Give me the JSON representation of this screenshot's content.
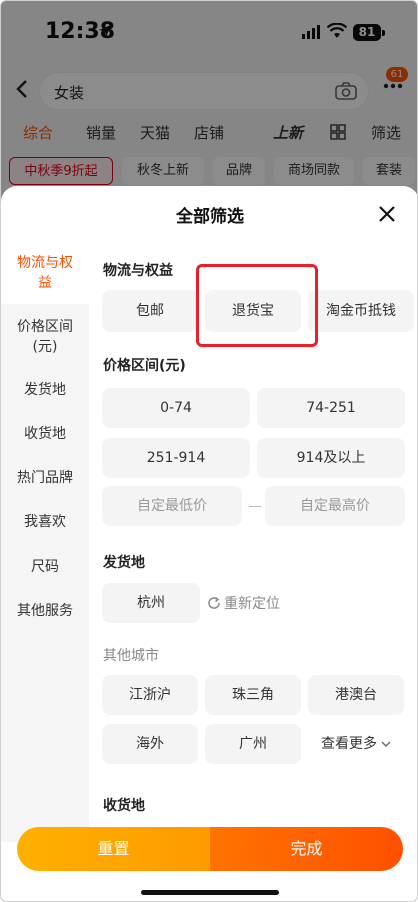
{
  "statusbar": {
    "time": "12:38",
    "battery": "81"
  },
  "search": {
    "query": "女装",
    "cart_badge": "61"
  },
  "sortbar": {
    "items": [
      "综合",
      "销量",
      "天猫",
      "店铺",
      "上新",
      "筛选"
    ]
  },
  "tags": [
    "中秋季9折起",
    "秋冬上新",
    "品牌",
    "商场同款",
    "套装"
  ],
  "sheet": {
    "title": "全部筛选",
    "nav": [
      "物流与权益",
      "价格区间(元)",
      "发货地",
      "收货地",
      "热门品牌",
      "我喜欢",
      "尺码",
      "其他服务"
    ],
    "logistics": {
      "title": "物流与权益",
      "options": [
        "包邮",
        "退货宝",
        "淘金币抵钱"
      ]
    },
    "price": {
      "title": "价格区间(元)",
      "ranges": [
        "0-74",
        "74-251",
        "251-914",
        "914及以上"
      ],
      "min_placeholder": "自定最低价",
      "max_placeholder": "自定最高价"
    },
    "ship_from": {
      "title": "发货地",
      "city": "杭州",
      "relocate": "重新定位"
    },
    "other_cities": {
      "title": "其他城市",
      "cities": [
        "江浙沪",
        "珠三角",
        "港澳台",
        "海外",
        "广州"
      ],
      "more": "查看更多"
    },
    "ship_to": {
      "title": "收货地"
    },
    "buttons": {
      "reset": "重置",
      "done": "完成"
    }
  }
}
